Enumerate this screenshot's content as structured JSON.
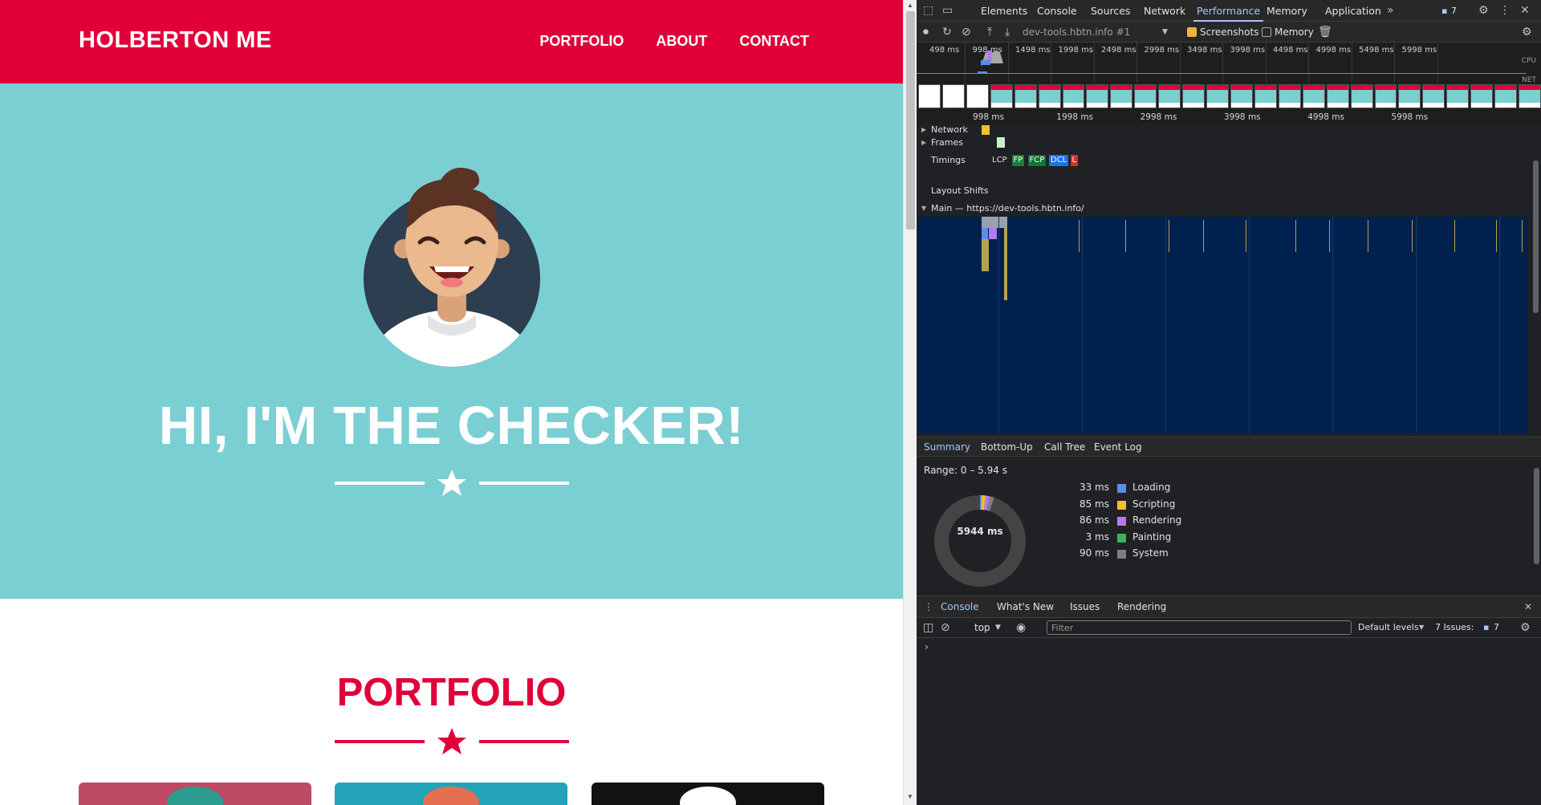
{
  "site": {
    "brand": "HOLBERTON ME",
    "nav": [
      "PORTFOLIO",
      "ABOUT",
      "CONTACT"
    ],
    "hero_title": "HI, I'M THE CHECKER!",
    "portfolio_title": "PORTFOLIO",
    "colors": {
      "primary": "#e10038",
      "hero_bg": "#7acfd3",
      "avatar_bg": "#2c3e50"
    }
  },
  "devtools": {
    "tabs": [
      "Elements",
      "Console",
      "Sources",
      "Network",
      "Performance",
      "Memory",
      "Application"
    ],
    "active_tab": "Performance",
    "issues_count": "7",
    "toolbar": {
      "target": "dev-tools.hbtn.info #1",
      "screenshots_label": "Screenshots",
      "screenshots_checked": true,
      "memory_label": "Memory",
      "memory_checked": false
    },
    "overview_ticks": [
      "498 ms",
      "998 ms",
      "1498 ms",
      "1998 ms",
      "2498 ms",
      "2998 ms",
      "3498 ms",
      "3998 ms",
      "4498 ms",
      "4998 ms",
      "5498 ms",
      "5998 ms"
    ],
    "overview_labels": {
      "cpu": "CPU",
      "net": "NET"
    },
    "ruler_ticks": [
      "998 ms",
      "1998 ms",
      "2998 ms",
      "3998 ms",
      "4998 ms",
      "5998 ms"
    ],
    "tracks": {
      "network": "Network",
      "frames": "Frames",
      "timings": "Timings",
      "layout_shifts": "Layout Shifts",
      "main": "Main — https://dev-tools.hbtn.info/"
    },
    "timings": [
      {
        "label": "LCP",
        "color": "#202124",
        "text": "#e3e3e3"
      },
      {
        "label": "FP",
        "color": "#188038",
        "text": "#ffffff"
      },
      {
        "label": "FCP",
        "color": "#137333",
        "text": "#ffffff"
      },
      {
        "label": "DCL",
        "color": "#1a73e8",
        "text": "#ffffff"
      },
      {
        "label": "L",
        "color": "#d93025",
        "text": "#ffffff"
      }
    ],
    "bottom_tabs": [
      "Summary",
      "Bottom-Up",
      "Call Tree",
      "Event Log"
    ],
    "summary": {
      "range": "Range: 0 – 5.94 s",
      "total": "5944 ms",
      "items": [
        {
          "value": "33 ms",
          "name": "Loading",
          "color": "#5b8ce6"
        },
        {
          "value": "85 ms",
          "name": "Scripting",
          "color": "#f2c029"
        },
        {
          "value": "86 ms",
          "name": "Rendering",
          "color": "#b37bf0"
        },
        {
          "value": "3 ms",
          "name": "Painting",
          "color": "#3bb35a"
        },
        {
          "value": "90 ms",
          "name": "System",
          "color": "#7e7e7e"
        }
      ]
    },
    "drawer_tabs": [
      "Console",
      "What's New",
      "Issues",
      "Rendering"
    ],
    "console": {
      "context": "top",
      "filter_placeholder": "Filter",
      "levels": "Default levels",
      "issues_label": "7 Issues:",
      "issues_count": "7",
      "prompt": "›"
    }
  }
}
